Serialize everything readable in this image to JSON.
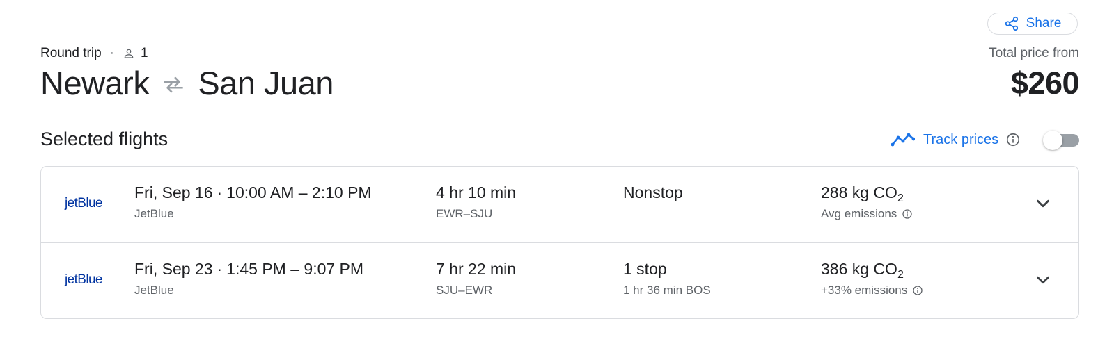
{
  "share": {
    "label": "Share",
    "icon": "share-icon"
  },
  "trip": {
    "type": "Round trip",
    "passengers": "1",
    "origin": "Newark",
    "destination": "San Juan"
  },
  "price": {
    "label": "Total price from",
    "value": "$260"
  },
  "section_title": "Selected flights",
  "track_prices": {
    "label": "Track prices",
    "enabled": false
  },
  "flights": [
    {
      "airline_logo": "jetBlue",
      "date": "Fri, Sep 16",
      "time_range": "10:00 AM – 2:10 PM",
      "airline": "JetBlue",
      "duration": "4 hr 10 min",
      "airports": "EWR–SJU",
      "stops": "Nonstop",
      "layover": "",
      "emissions_value": "288 kg CO",
      "emissions_sub": "2",
      "emissions_note": "Avg emissions"
    },
    {
      "airline_logo": "jetBlue",
      "date": "Fri, Sep 23",
      "time_range": "1:45 PM – 9:07 PM",
      "airline": "JetBlue",
      "duration": "7 hr 22 min",
      "airports": "SJU–EWR",
      "stops": "1 stop",
      "layover": "1 hr 36 min BOS",
      "emissions_value": "386 kg CO",
      "emissions_sub": "2",
      "emissions_note": "+33% emissions"
    }
  ],
  "colors": {
    "accent": "#1a73e8",
    "text": "#202124",
    "secondary": "#5f6368",
    "border": "#dadce0",
    "jetblue": "#0033a0"
  }
}
